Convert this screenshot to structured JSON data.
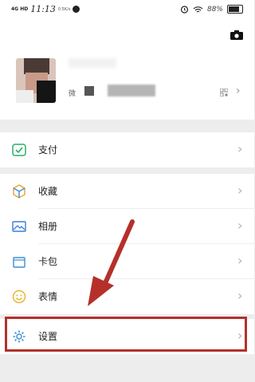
{
  "status_bar": {
    "network": "4G HD",
    "time": "11:13",
    "tiny_text": "0.5K/s",
    "battery_text": "88%"
  },
  "profile": {
    "wechat_id_label": "微"
  },
  "menu": {
    "pay": {
      "label": "支付",
      "icon": "wechat-pay-icon"
    },
    "favorites": {
      "label": "收藏",
      "icon": "cube-icon"
    },
    "album": {
      "label": "相册",
      "icon": "image-icon"
    },
    "cards": {
      "label": "卡包",
      "icon": "wallet-icon"
    },
    "stickers": {
      "label": "表情",
      "icon": "smile-icon"
    },
    "settings": {
      "label": "设置",
      "icon": "gear-icon"
    }
  },
  "colors": {
    "accent_green": "#2aae67",
    "annotation_red": "#b5302a",
    "background": "#ededed"
  }
}
